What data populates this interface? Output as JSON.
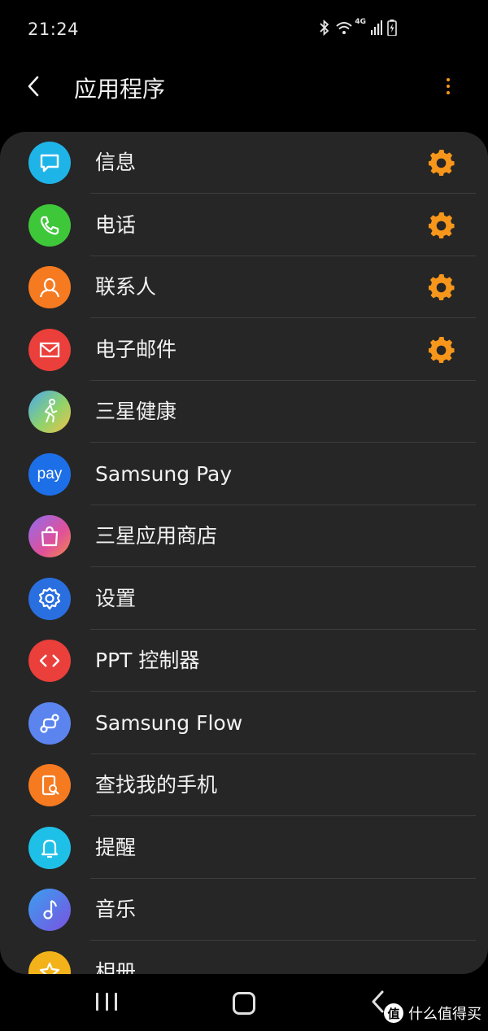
{
  "status_bar": {
    "time": "21:24",
    "network": "4G"
  },
  "header": {
    "title": "应用程序"
  },
  "apps": [
    {
      "label": "信息",
      "icon": "message-icon",
      "color": "#1fb4e8",
      "has_settings": true
    },
    {
      "label": "电话",
      "icon": "phone-icon",
      "color": "#3fc73a",
      "has_settings": true
    },
    {
      "label": "联系人",
      "icon": "contact-icon",
      "color": "#f57a20",
      "has_settings": true
    },
    {
      "label": "电子邮件",
      "icon": "email-icon",
      "color": "#ea3f3a",
      "has_settings": true
    },
    {
      "label": "三星健康",
      "icon": "health-icon",
      "color": "#6ab0e8",
      "has_settings": false
    },
    {
      "label": "Samsung Pay",
      "icon": "pay-icon",
      "color": "#1d6fe8",
      "has_settings": false
    },
    {
      "label": "三星应用商店",
      "icon": "store-icon",
      "color": "#c05ad8",
      "has_settings": false
    },
    {
      "label": "设置",
      "icon": "settings-icon",
      "color": "#2a6fe0",
      "has_settings": false
    },
    {
      "label": "PPT 控制器",
      "icon": "ppt-controller-icon",
      "color": "#ea3f3a",
      "has_settings": false
    },
    {
      "label": "Samsung Flow",
      "icon": "flow-icon",
      "color": "#5b84ee",
      "has_settings": false
    },
    {
      "label": "查找我的手机",
      "icon": "find-phone-icon",
      "color": "#f57a20",
      "has_settings": false
    },
    {
      "label": "提醒",
      "icon": "reminder-icon",
      "color": "#1fc0e8",
      "has_settings": false
    },
    {
      "label": "音乐",
      "icon": "music-icon",
      "color": "#5a6ae8",
      "has_settings": false
    },
    {
      "label": "相册",
      "icon": "gallery-icon",
      "color": "#f3b21a",
      "has_settings": false
    }
  ],
  "accent_color": "#f6961b",
  "watermark": {
    "text": "什么值得买",
    "logo": "值"
  }
}
